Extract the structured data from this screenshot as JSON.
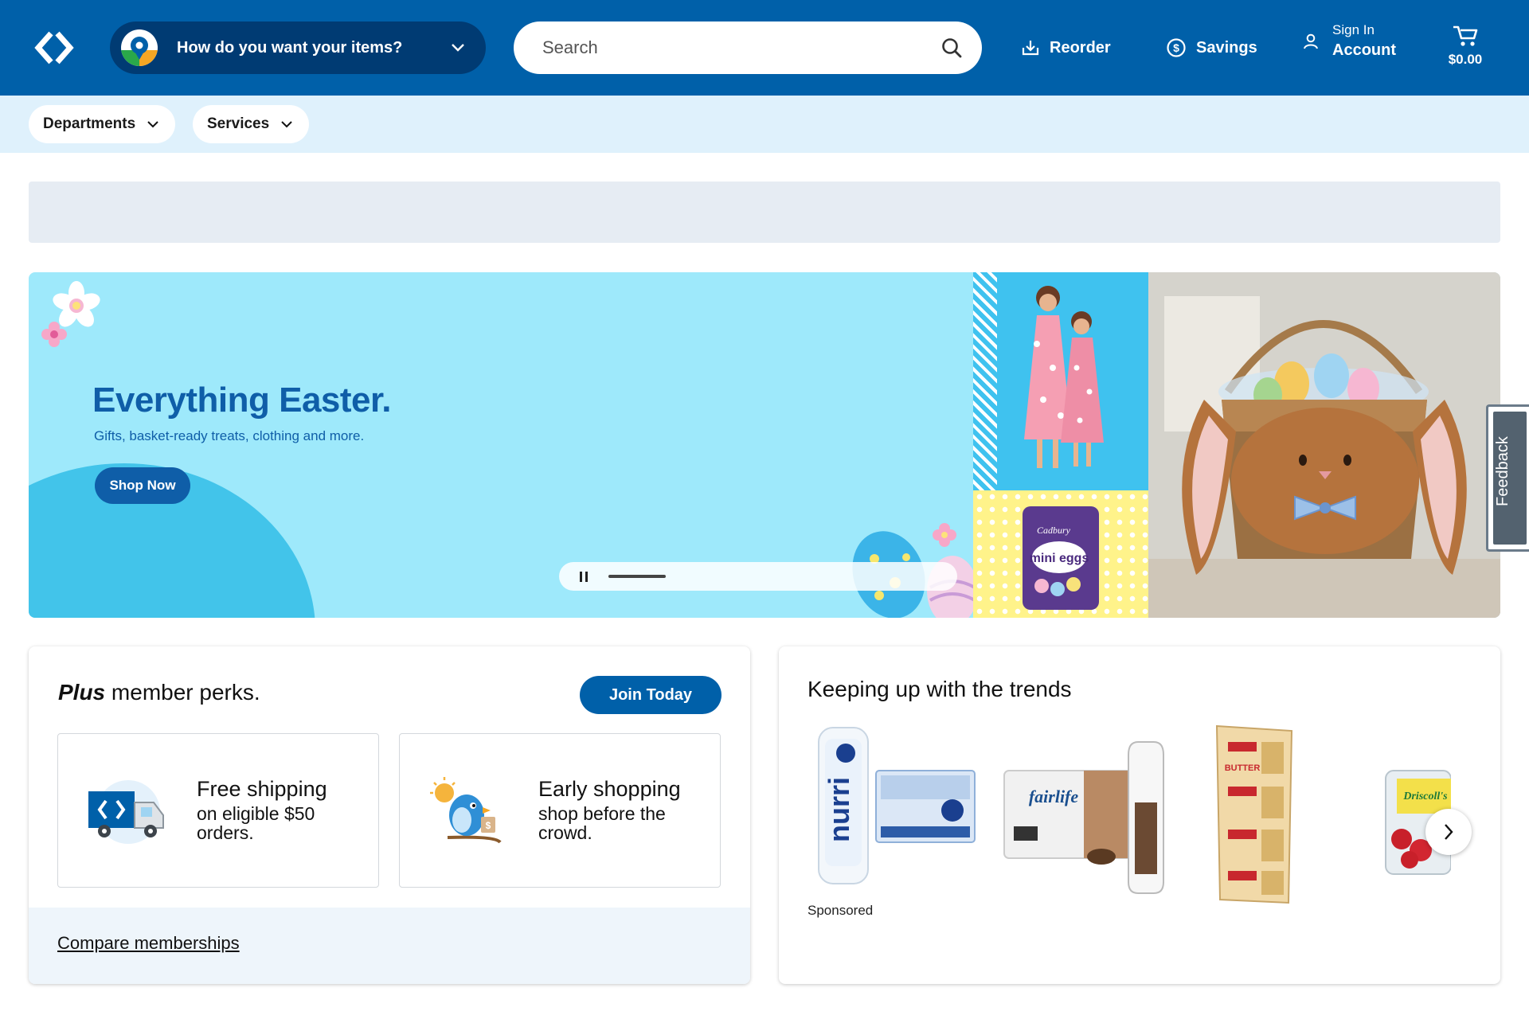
{
  "header": {
    "fulfillment_label": "How do you want your items?",
    "search_placeholder": "Search",
    "reorder_label": "Reorder",
    "savings_label": "Savings",
    "signin_label": "Sign In",
    "account_label": "Account",
    "cart_total": "$0.00"
  },
  "subnav": {
    "departments_label": "Departments",
    "services_label": "Services"
  },
  "hero": {
    "title": "Everything Easter.",
    "subtitle": "Gifts, basket-ready treats, clothing and more.",
    "cta_label": "Shop Now",
    "candy_brand": "Cadbury",
    "candy_name": "mini eggs"
  },
  "feedback_label": "Feedback",
  "perks": {
    "title_brand": "Plus",
    "title_rest": " member perks.",
    "join_label": "Join Today",
    "items": [
      {
        "heading": "Free shipping",
        "desc": "on eligible $50 orders."
      },
      {
        "heading": "Early shopping",
        "desc": "shop before the crowd."
      }
    ],
    "compare_link": "Compare memberships"
  },
  "trends": {
    "title": "Keeping up with the trends",
    "sponsored_label": "Sponsored",
    "products": [
      {
        "brand": "nurri",
        "icon": "protein-shake-pack-image"
      },
      {
        "brand": "fairlife",
        "icon": "fairlife-protein-pack-image"
      },
      {
        "brand": "BUTTER",
        "icon": "butter-pack-image"
      },
      {
        "brand": "Driscoll's",
        "icon": "strawberries-image"
      }
    ]
  },
  "colors": {
    "brand_blue": "#0060a9",
    "dark_blue": "#003b73",
    "hero_bg": "#9ee9fb",
    "subnav_bg": "#dff1fc"
  }
}
